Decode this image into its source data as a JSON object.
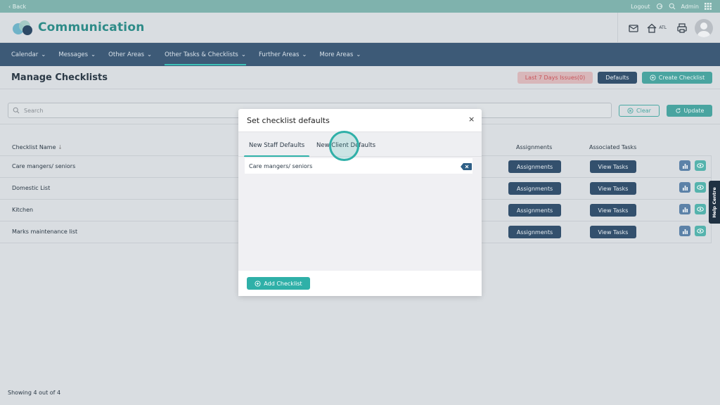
{
  "topbar": {
    "back": "‹ Back",
    "logout": "Logout",
    "user": "Admin"
  },
  "header": {
    "app_title": "Communication",
    "location_badge": "ATL"
  },
  "nav": {
    "items": [
      {
        "label": "Calendar"
      },
      {
        "label": "Messages"
      },
      {
        "label": "Other Areas"
      },
      {
        "label": "Other Tasks & Checklists"
      },
      {
        "label": "Further Areas"
      },
      {
        "label": "More Areas"
      }
    ]
  },
  "page": {
    "title": "Manage Checklists",
    "issues_label": "Last 7 Days Issues(0)",
    "defaults_label": "Defaults",
    "create_label": "Create Checklist"
  },
  "search": {
    "placeholder": "Search",
    "clear_label": "Clear",
    "update_label": "Update"
  },
  "table": {
    "headers": {
      "name": "Checklist Name",
      "assignments": "Assignments",
      "tasks": "Associated Tasks"
    },
    "rows": [
      {
        "name": "Care mangers/ seniors",
        "assign": "Assignments",
        "view": "View Tasks"
      },
      {
        "name": "Domestic List",
        "assign": "Assignments",
        "view": "View Tasks"
      },
      {
        "name": "Kitchen",
        "assign": "Assignments",
        "view": "View Tasks"
      },
      {
        "name": "Marks maintenance list",
        "assign": "Assignments",
        "view": "View Tasks"
      }
    ]
  },
  "help_label": "Help Centre",
  "footer": {
    "showing": "Showing 4 out of 4"
  },
  "modal": {
    "title": "Set checklist defaults",
    "close": "×",
    "tabs": [
      {
        "label": "New Staff Defaults"
      },
      {
        "label": "New Client Defaults"
      }
    ],
    "items": [
      {
        "label": "Care mangers/ seniors"
      }
    ],
    "add_label": "Add Checklist"
  },
  "colors": {
    "accent": "#2fb0a8",
    "nav_bg": "#3d5a77",
    "dark_button": "#33506d"
  }
}
